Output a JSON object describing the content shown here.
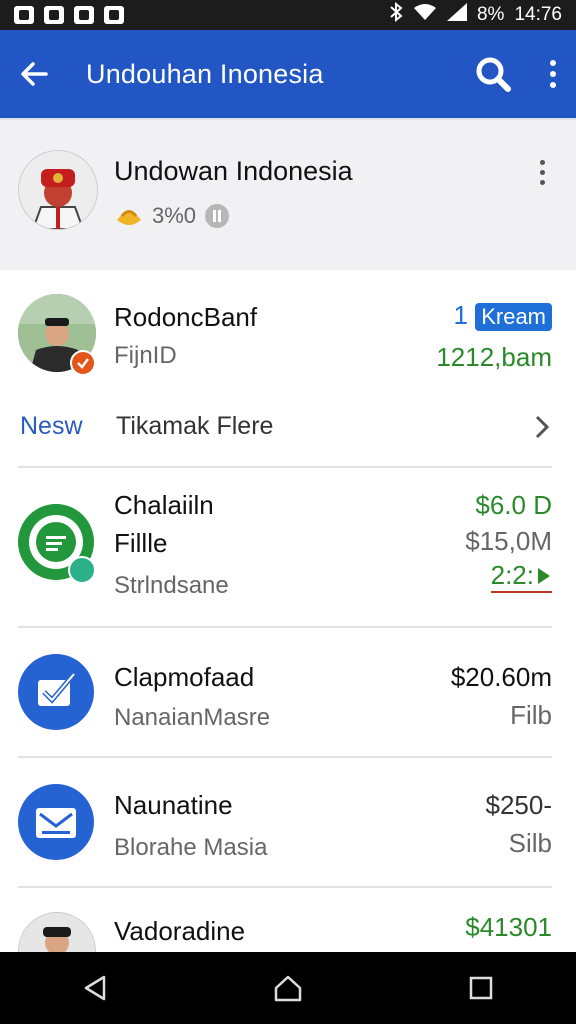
{
  "status_bar": {
    "battery": "8%",
    "time": "14:76"
  },
  "appbar": {
    "title": "Undouhan Inonesia"
  },
  "profile": {
    "name": "Undowan Indonesia",
    "points": "3%0"
  },
  "items": [
    {
      "title": "RodoncBanf",
      "subtitle": "FijnID",
      "badge_num": "1",
      "badge": "Kream",
      "right": "1212,bam"
    },
    {
      "new_label": "Nesw",
      "text": "Tikamak Flere"
    },
    {
      "title": "Chalaiiln",
      "title2": "Fillle",
      "subtitle": "Strlndsane",
      "amount": "$6.0 D",
      "amount2": "$15,0M",
      "trend": "2:2:"
    },
    {
      "title": "Clapmofaad",
      "subtitle": "NanaianMasre",
      "amount": "$20.60m",
      "amount2": "Filb"
    },
    {
      "title": "Naunatine",
      "subtitle": "Blorahe Masia",
      "amount": "$250-",
      "amount2": "Silb"
    },
    {
      "title": "Vadoradine",
      "amount": "$41301"
    }
  ],
  "colors": {
    "appbar": "#2256c5",
    "accent_green": "#2a8a2a",
    "icon_blue": "#2563d3"
  }
}
